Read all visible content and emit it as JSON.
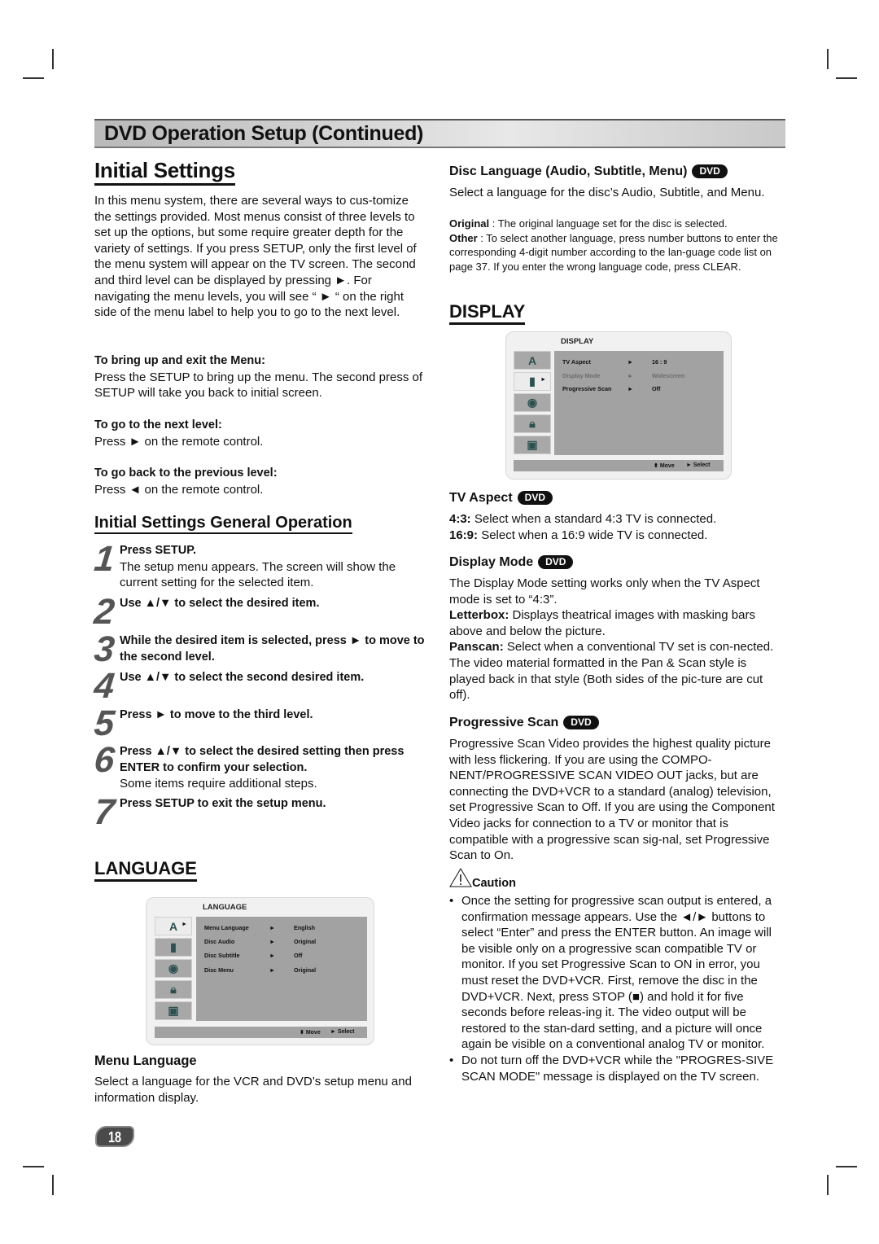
{
  "banner": {
    "title": "DVD Operation Setup (Continued)"
  },
  "left": {
    "heading": "Initial Settings",
    "intro": "In this menu system, there are several ways to cus-tomize the settings provided. Most menus consist of three levels to set up the options, but some require greater depth for the variety of settings. If you press SETUP, only the first level of the menu system will appear on the TV screen. The second and third level can be displayed by pressing ►. For navigating the menu levels, you will see “ ► “ on the right side of the menu label to help you to go to the next level.",
    "tips": [
      {
        "title": "To bring up and exit the Menu:",
        "text": "Press the SETUP to bring up the menu. The second press of SETUP will take you back to initial screen."
      },
      {
        "title": "To go to the next level:",
        "text": "Press ► on the remote control."
      },
      {
        "title": "To go back to the previous level:",
        "text": "Press ◄ on the remote control."
      }
    ],
    "general_heading": "Initial Settings General Operation",
    "steps": [
      {
        "num": "1",
        "bold": "Press SETUP.",
        "text": "The setup menu appears. The screen will show the current setting for the selected item."
      },
      {
        "num": "2",
        "bold": "Use ▲/▼ to select the desired item.",
        "text": ""
      },
      {
        "num": "3",
        "bold": "While the desired item is selected, press ► to move to the second level.",
        "text": ""
      },
      {
        "num": "4",
        "bold": "Use ▲/▼ to select the second desired item.",
        "text": ""
      },
      {
        "num": "5",
        "bold": "Press ► to move to the third level.",
        "text": ""
      },
      {
        "num": "6",
        "bold": "Press ▲/▼ to select the desired setting then press ENTER to confirm your selection.",
        "text": "Some items require additional steps."
      },
      {
        "num": "7",
        "bold": "Press SETUP to exit the setup menu.",
        "text": ""
      }
    ],
    "language_heading": "LANGUAGE",
    "language_menu": {
      "title": "LANGUAGE",
      "icons": [
        "language-icon",
        "display-icon",
        "audio-icon",
        "lock-icon",
        "others-icon"
      ],
      "rows": [
        {
          "label": "Menu Language",
          "arrow": "►",
          "value": "English"
        },
        {
          "label": "Disc Audio",
          "arrow": "►",
          "value": "Original"
        },
        {
          "label": "Disc Subtitle",
          "arrow": "►",
          "value": "Off"
        },
        {
          "label": "Disc Menu",
          "arrow": "►",
          "value": "Original"
        }
      ],
      "footer_move": "Move",
      "footer_select": "Select"
    },
    "menu_language": {
      "title": "Menu Language",
      "text": "Select a language for the VCR and DVD’s setup menu and information display."
    }
  },
  "right": {
    "disc_language": {
      "title": "Disc Language (Audio, Subtitle, Menu)",
      "badge": "DVD",
      "text": "Select a language for the disc’s Audio, Subtitle, and Menu.",
      "original_label": "Original",
      "original_text": " : The original language set for the disc is selected.",
      "other_label": "Other",
      "other_text": " : To select another language, press number buttons to enter the corresponding 4-digit number according to the lan-guage code list on page 37. If you enter the wrong language code, press CLEAR."
    },
    "display_heading": "DISPLAY",
    "display_menu": {
      "title": "DISPLAY",
      "rows": [
        {
          "label": "TV Aspect",
          "arrow": "►",
          "value": "16 : 9",
          "dim": false
        },
        {
          "label": "Display Mode",
          "arrow": "►",
          "value": "Widescreen",
          "dim": true
        },
        {
          "label": "Progressive Scan",
          "arrow": "►",
          "value": "Off",
          "dim": false
        }
      ],
      "footer_move": "Move",
      "footer_select": "Select"
    },
    "tv_aspect": {
      "title": "TV Aspect",
      "badge": "DVD",
      "l1_label": "4:3:",
      "l1_text": " Select when a standard 4:3 TV is connected.",
      "l2_label": "16:9:",
      "l2_text": " Select when a 16:9 wide TV is connected."
    },
    "display_mode": {
      "title": "Display Mode",
      "badge": "DVD",
      "text": "The Display Mode setting works only when the TV Aspect mode is set to “4:3”.",
      "letterbox_label": "Letterbox:",
      "letterbox_text": " Displays theatrical images with masking bars above and below the picture.",
      "panscan_label": "Panscan:",
      "panscan_text": " Select when a conventional TV set is con-nected. The video material formatted in the Pan & Scan style is played back in that style (Both sides of the pic-ture are cut off)."
    },
    "progressive_scan": {
      "title": "Progressive Scan",
      "badge": "DVD",
      "text": "Progressive Scan Video provides the highest quality picture with less flickering. If you are using the COMPO-NENT/PROGRESSIVE SCAN VIDEO OUT jacks, but are connecting the DVD+VCR to a standard (analog) television, set Progressive Scan to Off. If you are using the Component Video jacks for connection to a TV or monitor that is compatible with a progressive scan sig-nal, set Progressive Scan to On."
    },
    "caution": {
      "title": "Caution",
      "bullets": [
        "Once the setting for progressive scan output is entered, a confirmation message appears. Use the ◄/► buttons to select “Enter” and press the ENTER button. An image will be visible only on a progressive scan compatible TV or monitor. If you set Progressive Scan to ON in error, you must reset the DVD+VCR. First, remove the disc in the DVD+VCR. Next, press STOP (■) and hold it for five seconds before releas-ing it. The video output will be restored to the stan-dard setting, and a picture will once again be visible on a conventional analog TV or monitor.",
        "Do not turn off the DVD+VCR while the \"PROGRES-SIVE SCAN MODE\" message is displayed on the TV screen."
      ]
    }
  },
  "page_number": "18"
}
